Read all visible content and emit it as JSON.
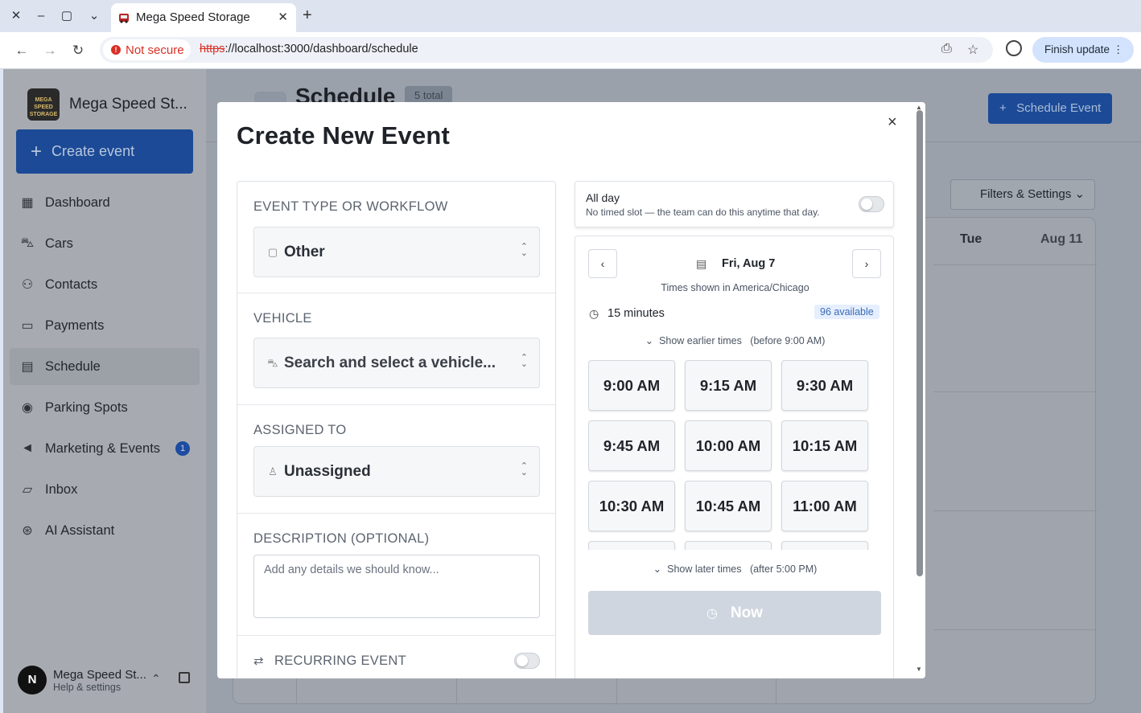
{
  "browser": {
    "tab_title": "Mega Speed Storage",
    "not_secure": "Not secure",
    "url_scheme": "https",
    "url_rest": "://localhost:3000/dashboard/schedule",
    "finish_update": "Finish update"
  },
  "sidebar": {
    "brand": "Mega Speed St...",
    "logo_text": "MEGA SPEED STORAGE",
    "create_event": "Create event",
    "items": [
      {
        "label": "Dashboard",
        "icon": "grid-icon"
      },
      {
        "label": "Cars",
        "icon": "car-icon"
      },
      {
        "label": "Contacts",
        "icon": "users-icon"
      },
      {
        "label": "Payments",
        "icon": "card-icon"
      },
      {
        "label": "Schedule",
        "icon": "calendar-icon"
      },
      {
        "label": "Parking Spots",
        "icon": "map-pin-icon"
      },
      {
        "label": "Marketing & Events",
        "icon": "megaphone-icon",
        "badge": "1"
      },
      {
        "label": "Inbox",
        "icon": "chat-icon"
      },
      {
        "label": "AI Assistant",
        "icon": "ai-icon"
      }
    ],
    "account": {
      "avatar": "N",
      "name": "Mega Speed St...",
      "sub": "Help & settings"
    }
  },
  "main": {
    "title": "Schedule",
    "count": "5 total",
    "schedule_button": "Schedule Event",
    "filters": "Filters & Settings",
    "calendar": {
      "day": "Tue",
      "date": "Aug 11"
    }
  },
  "modal": {
    "title": "Create New Event",
    "event_type": {
      "label": "EVENT TYPE OR WORKFLOW",
      "value": "Other"
    },
    "vehicle": {
      "label": "VEHICLE",
      "placeholder": "Search and select a vehicle..."
    },
    "assigned": {
      "label": "ASSIGNED TO",
      "value": "Unassigned"
    },
    "description": {
      "label": "DESCRIPTION (OPTIONAL)",
      "placeholder": "Add any details we should know..."
    },
    "recurring": {
      "label": "RECURRING EVENT",
      "enabled": false
    },
    "all_day": {
      "title": "All day",
      "subtitle": "No timed slot — the team can do this anytime that day.",
      "enabled": false
    },
    "picker": {
      "date": "Fri, Aug 7",
      "timezone": "Times shown in America/Chicago",
      "duration": "15 minutes",
      "available": "96 available",
      "show_earlier": "Show earlier times",
      "earlier_hint": "(before 9:00 AM)",
      "show_later": "Show later times",
      "later_hint": "(after 5:00 PM)",
      "slots": [
        "9:00 AM",
        "9:15 AM",
        "9:30 AM",
        "9:45 AM",
        "10:00 AM",
        "10:15 AM",
        "10:30 AM",
        "10:45 AM",
        "11:00 AM",
        "",
        "",
        ""
      ],
      "now_button": "Now"
    }
  },
  "colors": {
    "primary": "#1c4a96",
    "accent_badge": "#e6efff",
    "danger": "#d93025"
  }
}
